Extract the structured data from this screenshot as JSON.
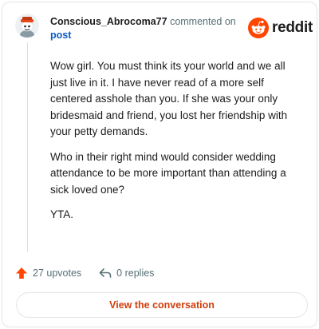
{
  "comment": {
    "username": "Conscious_Abrocoma77",
    "meta_text": "commented on",
    "post_link": "post",
    "paragraphs": [
      "Wow girl. You must think its your world and we all just live in it. I have never read of a more self centered asshole than you. If she was your only bridesmaid and friend, you lost her friendship with your petty demands.",
      "Who in their right mind would consider wedding attendance to be more important than attending a sick loved one?",
      "YTA."
    ]
  },
  "brand": {
    "wordmark": "reddit",
    "color": "#ff4500"
  },
  "actions": {
    "upvotes": "27 upvotes",
    "replies": "0 replies",
    "upvote_color": "#ff4500"
  },
  "cta": {
    "label": "View the conversation"
  },
  "icons": {
    "upvote": "upvote-arrow-icon",
    "reply": "reply-arrow-icon",
    "logo": "reddit-snoo-icon",
    "avatar": "user-avatar"
  }
}
